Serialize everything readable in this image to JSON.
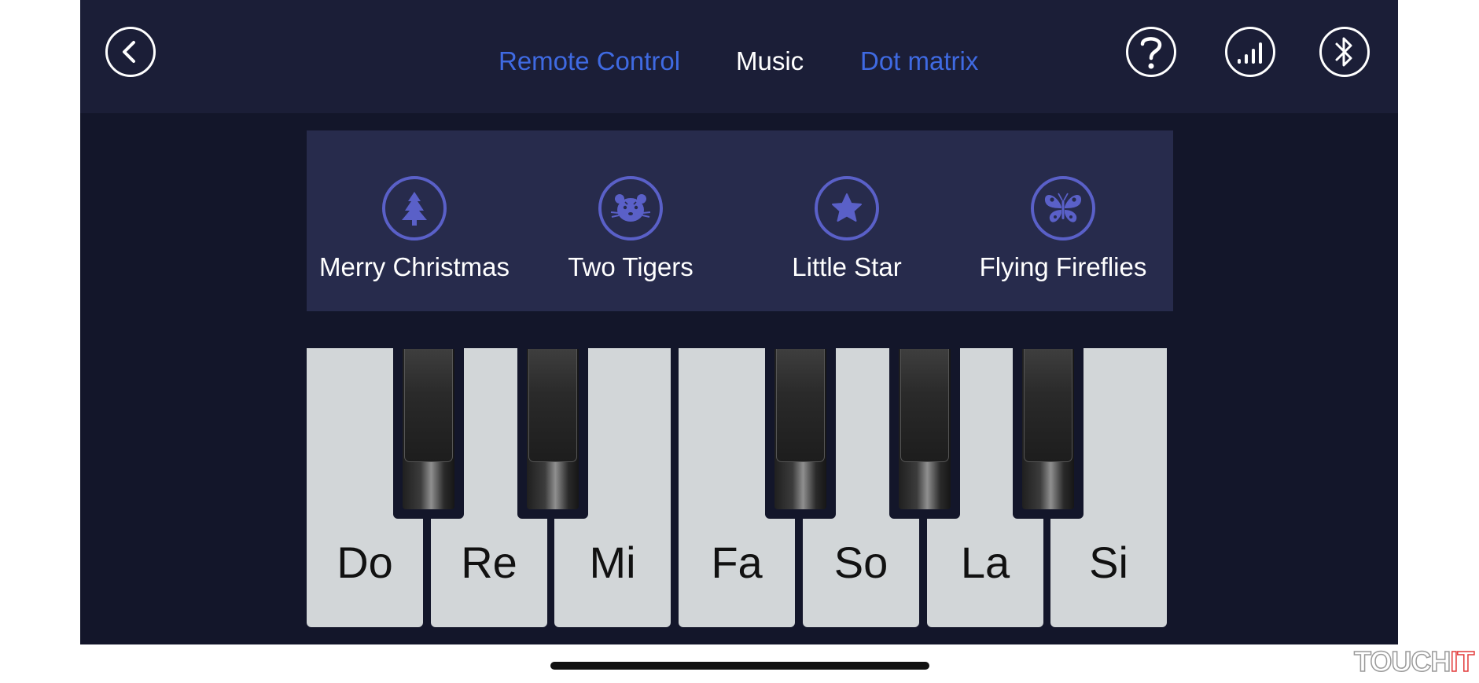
{
  "header": {
    "back_icon": "chevron-left-icon",
    "help_icon": "question-mark-icon",
    "signal_icon": "signal-bars-icon",
    "bluetooth_icon": "bluetooth-icon",
    "tabs": [
      {
        "label": "Remote Control",
        "active": false
      },
      {
        "label": "Music",
        "active": true
      },
      {
        "label": "Dot matrix",
        "active": false
      }
    ]
  },
  "songs": [
    {
      "label": "Merry Christmas",
      "icon": "christmas-tree-icon"
    },
    {
      "label": "Two Tigers",
      "icon": "tiger-icon"
    },
    {
      "label": "Little Star",
      "icon": "star-icon"
    },
    {
      "label": "Flying Fireflies",
      "icon": "butterfly-icon"
    }
  ],
  "piano": {
    "white_keys": [
      "Do",
      "Re",
      "Mi",
      "Fa",
      "So",
      "La",
      "Si"
    ],
    "black_key_count": 5
  },
  "watermark": {
    "part1": "TOUCH",
    "part2": "IT"
  },
  "colors": {
    "background": "#13162a",
    "header": "#1b1e37",
    "panel": "#272b4c",
    "accent_tab": "#3f6ae2",
    "icon_ring": "#5a60c8",
    "white_key": "#d2d6d8"
  }
}
